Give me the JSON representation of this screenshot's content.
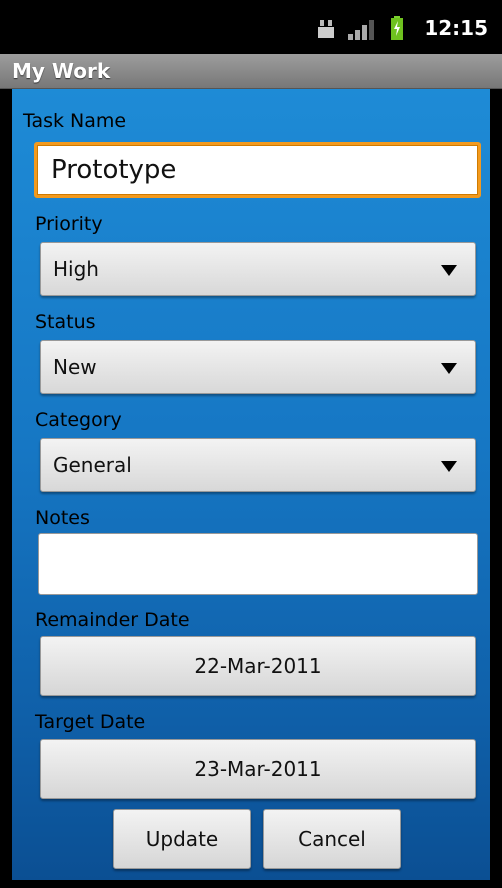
{
  "status_bar": {
    "time": "12:15",
    "icons": [
      "usb-icon",
      "signal-icon",
      "battery-charging-icon"
    ]
  },
  "app": {
    "title": "My Work"
  },
  "form": {
    "task_name": {
      "label": "Task Name",
      "value": "Prototype"
    },
    "priority": {
      "label": "Priority",
      "value": "High"
    },
    "status": {
      "label": "Status",
      "value": "New"
    },
    "category": {
      "label": "Category",
      "value": "General"
    },
    "notes": {
      "label": "Notes",
      "value": ""
    },
    "remainder_date": {
      "label": "Remainder Date",
      "value": "22-Mar-2011"
    },
    "target_date": {
      "label": "Target Date",
      "value": "23-Mar-2011"
    }
  },
  "actions": {
    "update_label": "Update",
    "cancel_label": "Cancel"
  },
  "colors": {
    "background_blue": "#1677c4",
    "focus_orange": "#f39a1e",
    "title_bar_gray": "#8a8a8a"
  }
}
